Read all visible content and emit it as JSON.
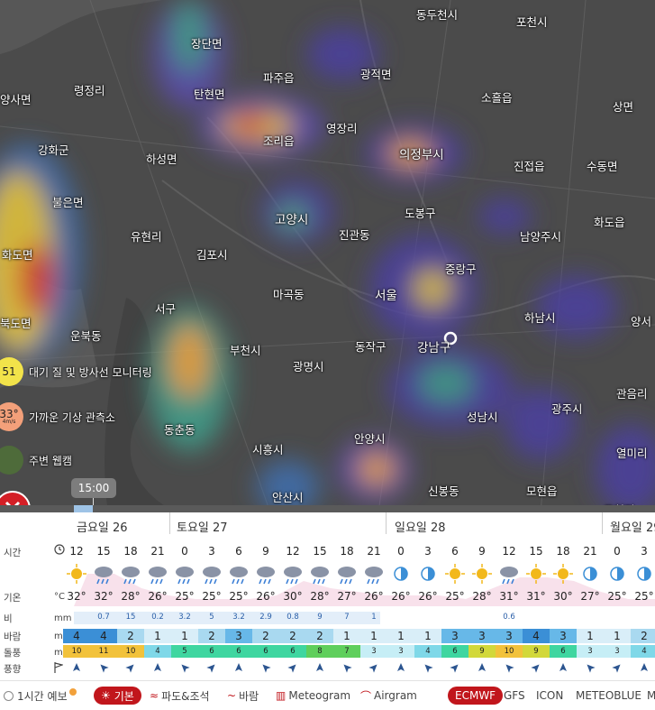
{
  "map": {
    "places": [
      {
        "name": "동두천시"
      },
      {
        "name": "포천시"
      },
      {
        "name": "장단면"
      },
      {
        "name": "파주읍"
      },
      {
        "name": "광적면"
      },
      {
        "name": "령정리"
      },
      {
        "name": "탄현면"
      },
      {
        "name": "소흘읍"
      },
      {
        "name": "상면"
      },
      {
        "name": "양사면"
      },
      {
        "name": "영장리"
      },
      {
        "name": "조리읍"
      },
      {
        "name": "의정부시"
      },
      {
        "name": "강화군"
      },
      {
        "name": "하성면"
      },
      {
        "name": "진접읍"
      },
      {
        "name": "수동면"
      },
      {
        "name": "불은면"
      },
      {
        "name": "고양시"
      },
      {
        "name": "도봉구"
      },
      {
        "name": "화도읍"
      },
      {
        "name": "유현리"
      },
      {
        "name": "진관동"
      },
      {
        "name": "김포시"
      },
      {
        "name": "남양주시"
      },
      {
        "name": "화도면"
      },
      {
        "name": "중랑구"
      },
      {
        "name": "마곡동"
      },
      {
        "name": "서울"
      },
      {
        "name": "서구"
      },
      {
        "name": "하남시"
      },
      {
        "name": "북도면"
      },
      {
        "name": "운북동"
      },
      {
        "name": "양서"
      },
      {
        "name": "부천시"
      },
      {
        "name": "동작구"
      },
      {
        "name": "강남구"
      },
      {
        "name": "광명시"
      },
      {
        "name": "관음리"
      },
      {
        "name": "광주시"
      },
      {
        "name": "성남시"
      },
      {
        "name": "동춘동"
      },
      {
        "name": "시흥시"
      },
      {
        "name": "안양시"
      },
      {
        "name": "열미리"
      },
      {
        "name": "신봉동"
      },
      {
        "name": "모현읍"
      },
      {
        "name": "안산시"
      },
      {
        "name": "도척면"
      }
    ]
  },
  "side": {
    "air_value": "51",
    "air_label": "대기 질 및 방사선 모니터링",
    "station_value": "33°",
    "station_sub": "4m/s",
    "station_label": "가까운 기상 관측소",
    "webcam_label": "주변 웹캠"
  },
  "timeline": {
    "current_time": "15:00",
    "progress": 0.13
  },
  "days": [
    {
      "label": "금요일 26"
    },
    {
      "label": "토요일 27"
    },
    {
      "label": "일요일 28"
    },
    {
      "label": "월요일 29"
    }
  ],
  "row_labels": {
    "time": "시간",
    "temp": "기온",
    "temp_unit": "°C",
    "rain": "비",
    "rain_unit": "mm",
    "wind": "바람",
    "wind_unit": "m/s",
    "gust": "돌풍",
    "gust_unit": "m/s",
    "dir": "풍향"
  },
  "hours": [
    "12",
    "15",
    "18",
    "21",
    "0",
    "3",
    "6",
    "9",
    "12",
    "15",
    "18",
    "21",
    "0",
    "3",
    "6",
    "9",
    "12",
    "15",
    "18",
    "21",
    "0",
    "3"
  ],
  "temps": [
    "32°",
    "32°",
    "28°",
    "26°",
    "25°",
    "25°",
    "25°",
    "26°",
    "30°",
    "28°",
    "27°",
    "26°",
    "26°",
    "26°",
    "25°",
    "28°",
    "31°",
    "31°",
    "30°",
    "27°",
    "25°",
    "25°"
  ],
  "rain": [
    "",
    "0.7",
    "15",
    "0.2",
    "3.2",
    "5",
    "3.2",
    "2.9",
    "0.8",
    "9",
    "7",
    "1",
    "",
    "",
    "",
    "",
    "0.6",
    "",
    "",
    "",
    "",
    ""
  ],
  "wind": [
    "4",
    "4",
    "2",
    "1",
    "1",
    "2",
    "3",
    "2",
    "2",
    "2",
    "1",
    "1",
    "1",
    "1",
    "3",
    "3",
    "3",
    "4",
    "3",
    "1",
    "1",
    "2"
  ],
  "gust": [
    "10",
    "11",
    "10",
    "4",
    "5",
    "6",
    "6",
    "6",
    "6",
    "8",
    "7",
    "3",
    "3",
    "4",
    "6",
    "9",
    "10",
    "9",
    "6",
    "3",
    "3",
    "4"
  ],
  "footer": {
    "hourly": "1시간 예보",
    "basic": "기본",
    "waves": "파도&조석",
    "wind": "바람",
    "meteogram": "Meteogram",
    "airgram": "Airgram",
    "models": [
      "ECMWF",
      "GFS",
      "ICON",
      "METEOBLUE",
      "MB"
    ]
  },
  "colors": {
    "accent": "#c1161c",
    "precip": "#6fa8dc"
  }
}
